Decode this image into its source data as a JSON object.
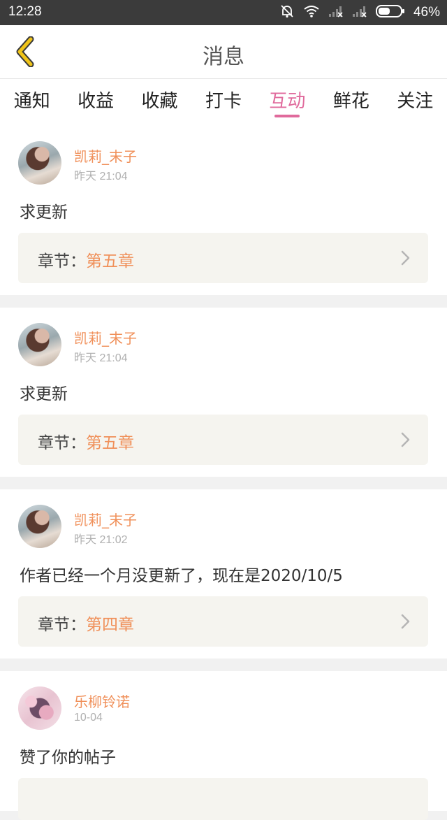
{
  "status_bar": {
    "time": "12:28",
    "battery": "46%",
    "icons": [
      "mute-bell-icon",
      "wifi-icon",
      "signal-icon",
      "signal-icon",
      "battery-icon"
    ]
  },
  "header": {
    "title": "消息",
    "back_icon": "chevron-left-icon",
    "back_color": "#f0c419"
  },
  "tabs": [
    {
      "label": "通知"
    },
    {
      "label": "收益"
    },
    {
      "label": "收藏"
    },
    {
      "label": "打卡"
    },
    {
      "label": "互动",
      "active": true
    },
    {
      "label": "鲜花"
    },
    {
      "label": "关注"
    }
  ],
  "colors": {
    "accent": "#e06a9c",
    "username": "#f0905a",
    "chapter_value": "#f0905a"
  },
  "messages": [
    {
      "username": "凯莉_末子",
      "time": "昨天 21:04",
      "text": "求更新",
      "chapter_label": "章节",
      "chapter_sep": "：",
      "chapter_value": "第五章"
    },
    {
      "username": "凯莉_末子",
      "time": "昨天 21:04",
      "text": "求更新",
      "chapter_label": "章节",
      "chapter_sep": "：",
      "chapter_value": "第五章"
    },
    {
      "username": "凯莉_末子",
      "time": "昨天 21:02",
      "text": "作者已经一个月没更新了，现在是2020/10/5",
      "chapter_label": "章节",
      "chapter_sep": "：",
      "chapter_value": "第四章"
    },
    {
      "username": "乐柳铃诺",
      "time": "10-04",
      "text": "赞了你的帖子"
    }
  ]
}
